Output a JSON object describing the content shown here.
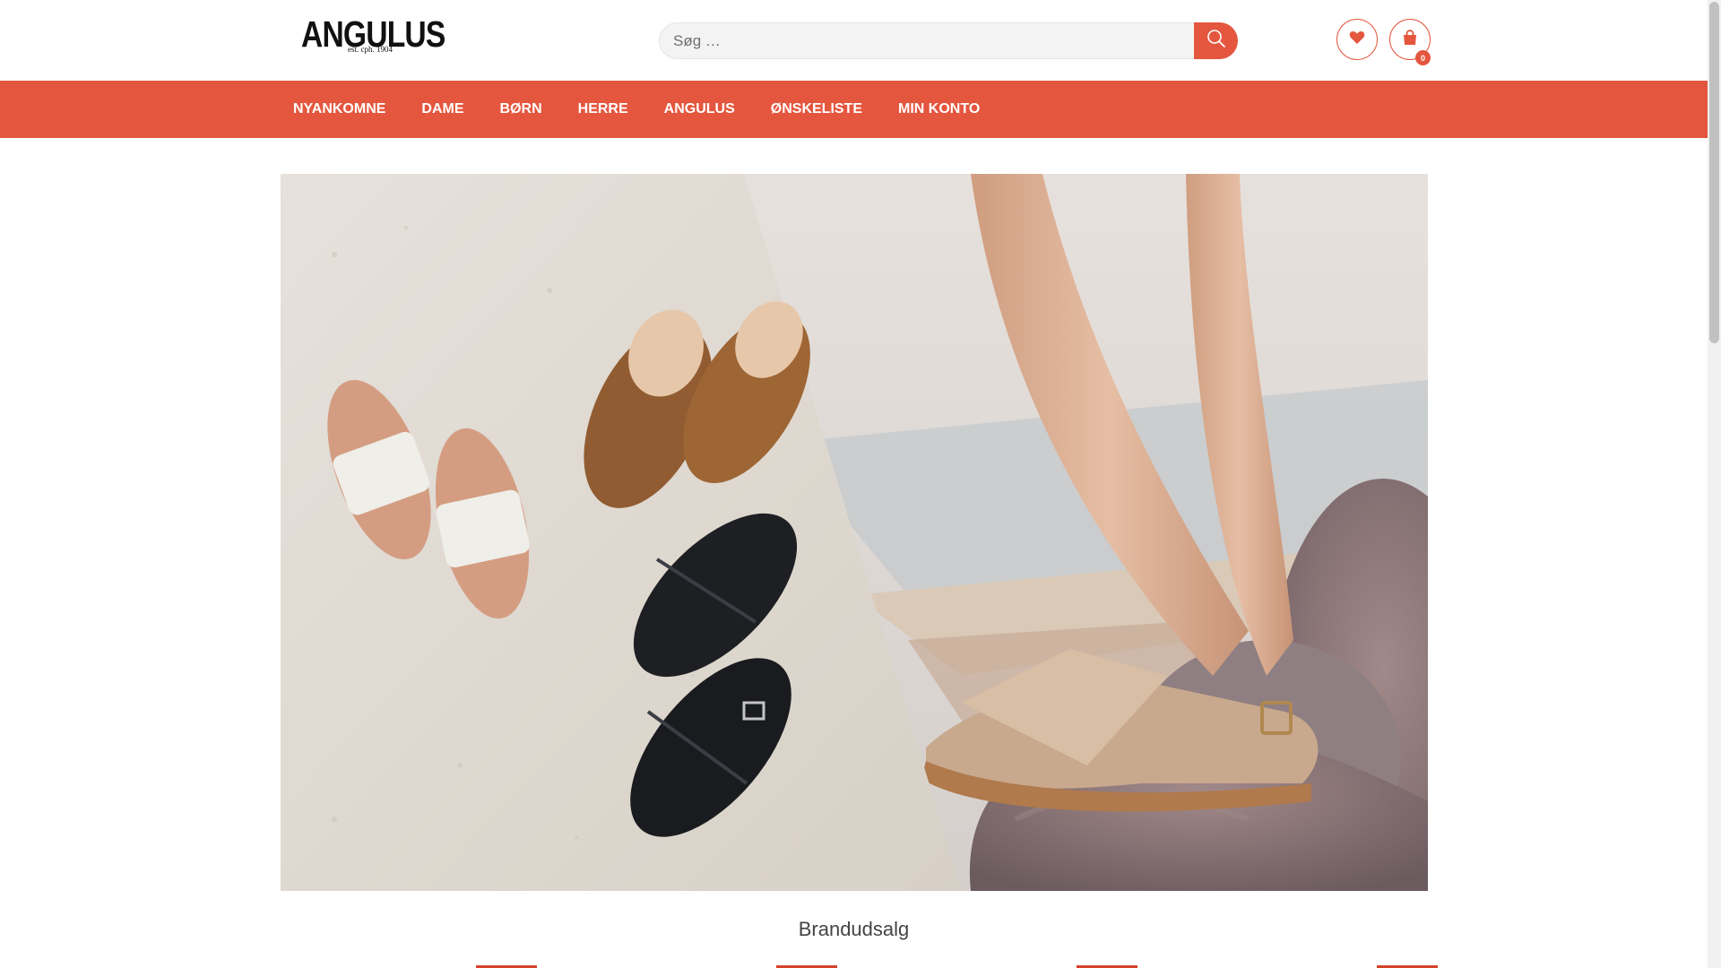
{
  "brand": {
    "name": "ANGULUS",
    "tagline": "est. cph. 1904"
  },
  "search": {
    "placeholder": "Søg …",
    "value": ""
  },
  "header": {
    "cart_count": "0"
  },
  "nav": {
    "items": [
      {
        "label": "NYANKOMNE"
      },
      {
        "label": "DAME"
      },
      {
        "label": "BØRN"
      },
      {
        "label": "HERRE"
      },
      {
        "label": "ANGULUS"
      },
      {
        "label": "ØNSKELISTE"
      },
      {
        "label": "MIN KONTO"
      }
    ]
  },
  "section": {
    "title": "Brandudsalg"
  },
  "colors": {
    "accent": "#e4563e",
    "nav_text": "#ffffff",
    "search_bg": "#f3f3f3"
  },
  "icons": [
    "search-icon",
    "heart-icon",
    "shopping-bag-icon"
  ]
}
